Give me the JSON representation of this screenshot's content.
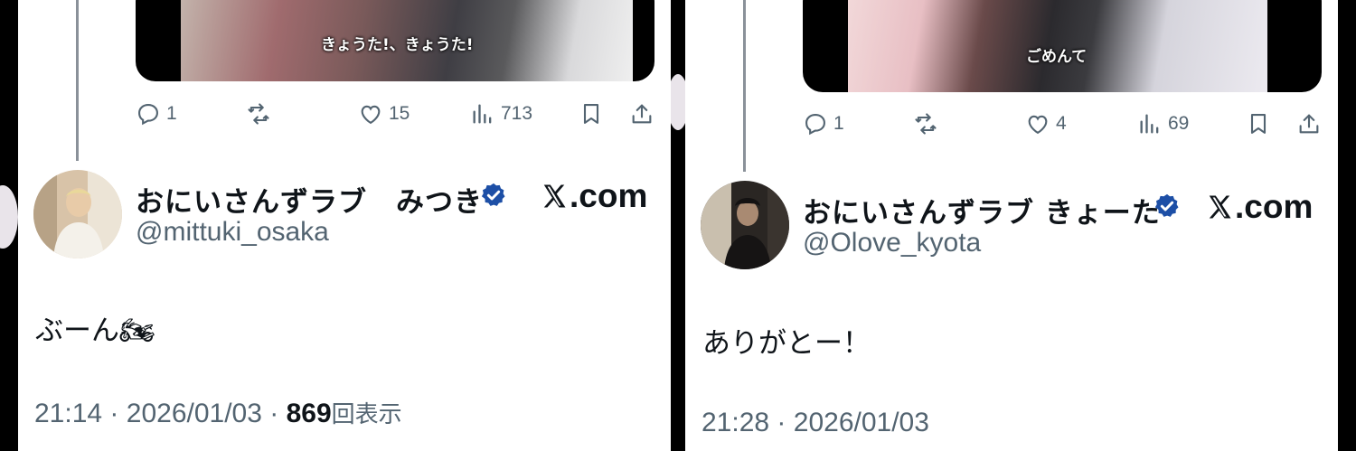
{
  "colors": {
    "background": "#000000",
    "panel": "#ffffff",
    "text_primary": "#0f1419",
    "text_secondary": "#536471",
    "verified_badge": "#1d4fa6"
  },
  "left_tweet": {
    "media_caption": "きょうた!、きょうた!",
    "actions": {
      "reply_count": "1",
      "repost_count": "",
      "like_count": "15",
      "views_count": "713"
    },
    "author": {
      "display_name": "おにいさんずラブ　みつき",
      "handle": "@mittuki_osaka",
      "verified": true
    },
    "source_label": ".com",
    "text": "ぶーん🏍",
    "time": "21:14",
    "separator": "·",
    "date": "2026/01/03",
    "separator2": "·",
    "views": "869",
    "views_label": "回表示"
  },
  "right_tweet": {
    "media_caption": "ごめんて",
    "actions": {
      "reply_count": "1",
      "repost_count": "",
      "like_count": "4",
      "views_count": "69"
    },
    "author": {
      "display_name": "おにいさんずラブ きょーた",
      "handle": "@Olove_kyota",
      "verified": true
    },
    "source_label": ".com",
    "text": "ありがとー！",
    "time": "21:28",
    "separator": "·",
    "date": "2026/01/03"
  }
}
